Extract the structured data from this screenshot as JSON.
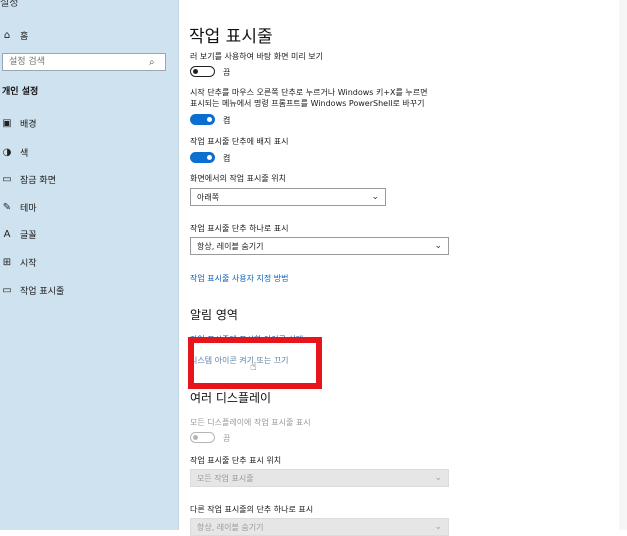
{
  "sidebar": {
    "top_label": "설정",
    "home": {
      "label": "홈",
      "icon": "home-icon"
    },
    "search": {
      "placeholder": "설정 검색",
      "icon": "search-icon"
    },
    "section_title": "개인 설정",
    "items": [
      {
        "label": "배경",
        "icon": "image-icon"
      },
      {
        "label": "색",
        "icon": "palette-icon"
      },
      {
        "label": "잠금 화면",
        "icon": "lock-screen-icon"
      },
      {
        "label": "테마",
        "icon": "theme-icon"
      },
      {
        "label": "글꼴",
        "icon": "font-icon"
      },
      {
        "label": "시작",
        "icon": "start-icon"
      },
      {
        "label": "작업 표시줄",
        "icon": "taskbar-icon"
      }
    ]
  },
  "main": {
    "title": "작업 표시줄",
    "peek_label": "러 보기를 사용하여 바탕 화면 미리 보기",
    "peek_state": "끔",
    "powershell_label_1": "시작 단추를 마우스 오른쪽 단추로 누르거나 Windows 키+X를 누르면",
    "powershell_label_2": "표시되는 메뉴에서 명령 프롬프트를 Windows PowerShell로 바꾸기",
    "powershell_state": "켬",
    "badges_label": "작업 표시줄 단추에 배지 표시",
    "badges_state": "켬",
    "location_label": "화면에서의 작업 표시줄 위치",
    "location_value": "아래쪽",
    "combine_label": "작업 표시줄 단추 하나로 표시",
    "combine_value": "항상, 레이블 숨기기",
    "customize_link": "작업 표시줄 사용자 지정 방법",
    "notification_heading": "알림 영역",
    "select_icons_link": "작업 표시줄에 표시할 아이콘 선택",
    "system_icons_link": "시스템 아이콘 켜기 또는 끄기",
    "multi_display_heading": "여러 디스플레이",
    "all_displays_label": "모든 디스플레이에 작업 표시줄 표시",
    "all_displays_state": "끔",
    "show_buttons_label": "작업 표시줄 단추 표시 위치",
    "show_buttons_value": "모든 작업 표시줄",
    "other_combine_label": "다른 작업 표시줄의 단추 하나로 표시",
    "other_combine_value": "항상, 레이블 숨기기"
  },
  "colors": {
    "accent": "#0a6fd1",
    "link": "#0a63b8",
    "highlight_box": "#e8141b",
    "sidebar_bg": "#cfe2ef"
  }
}
